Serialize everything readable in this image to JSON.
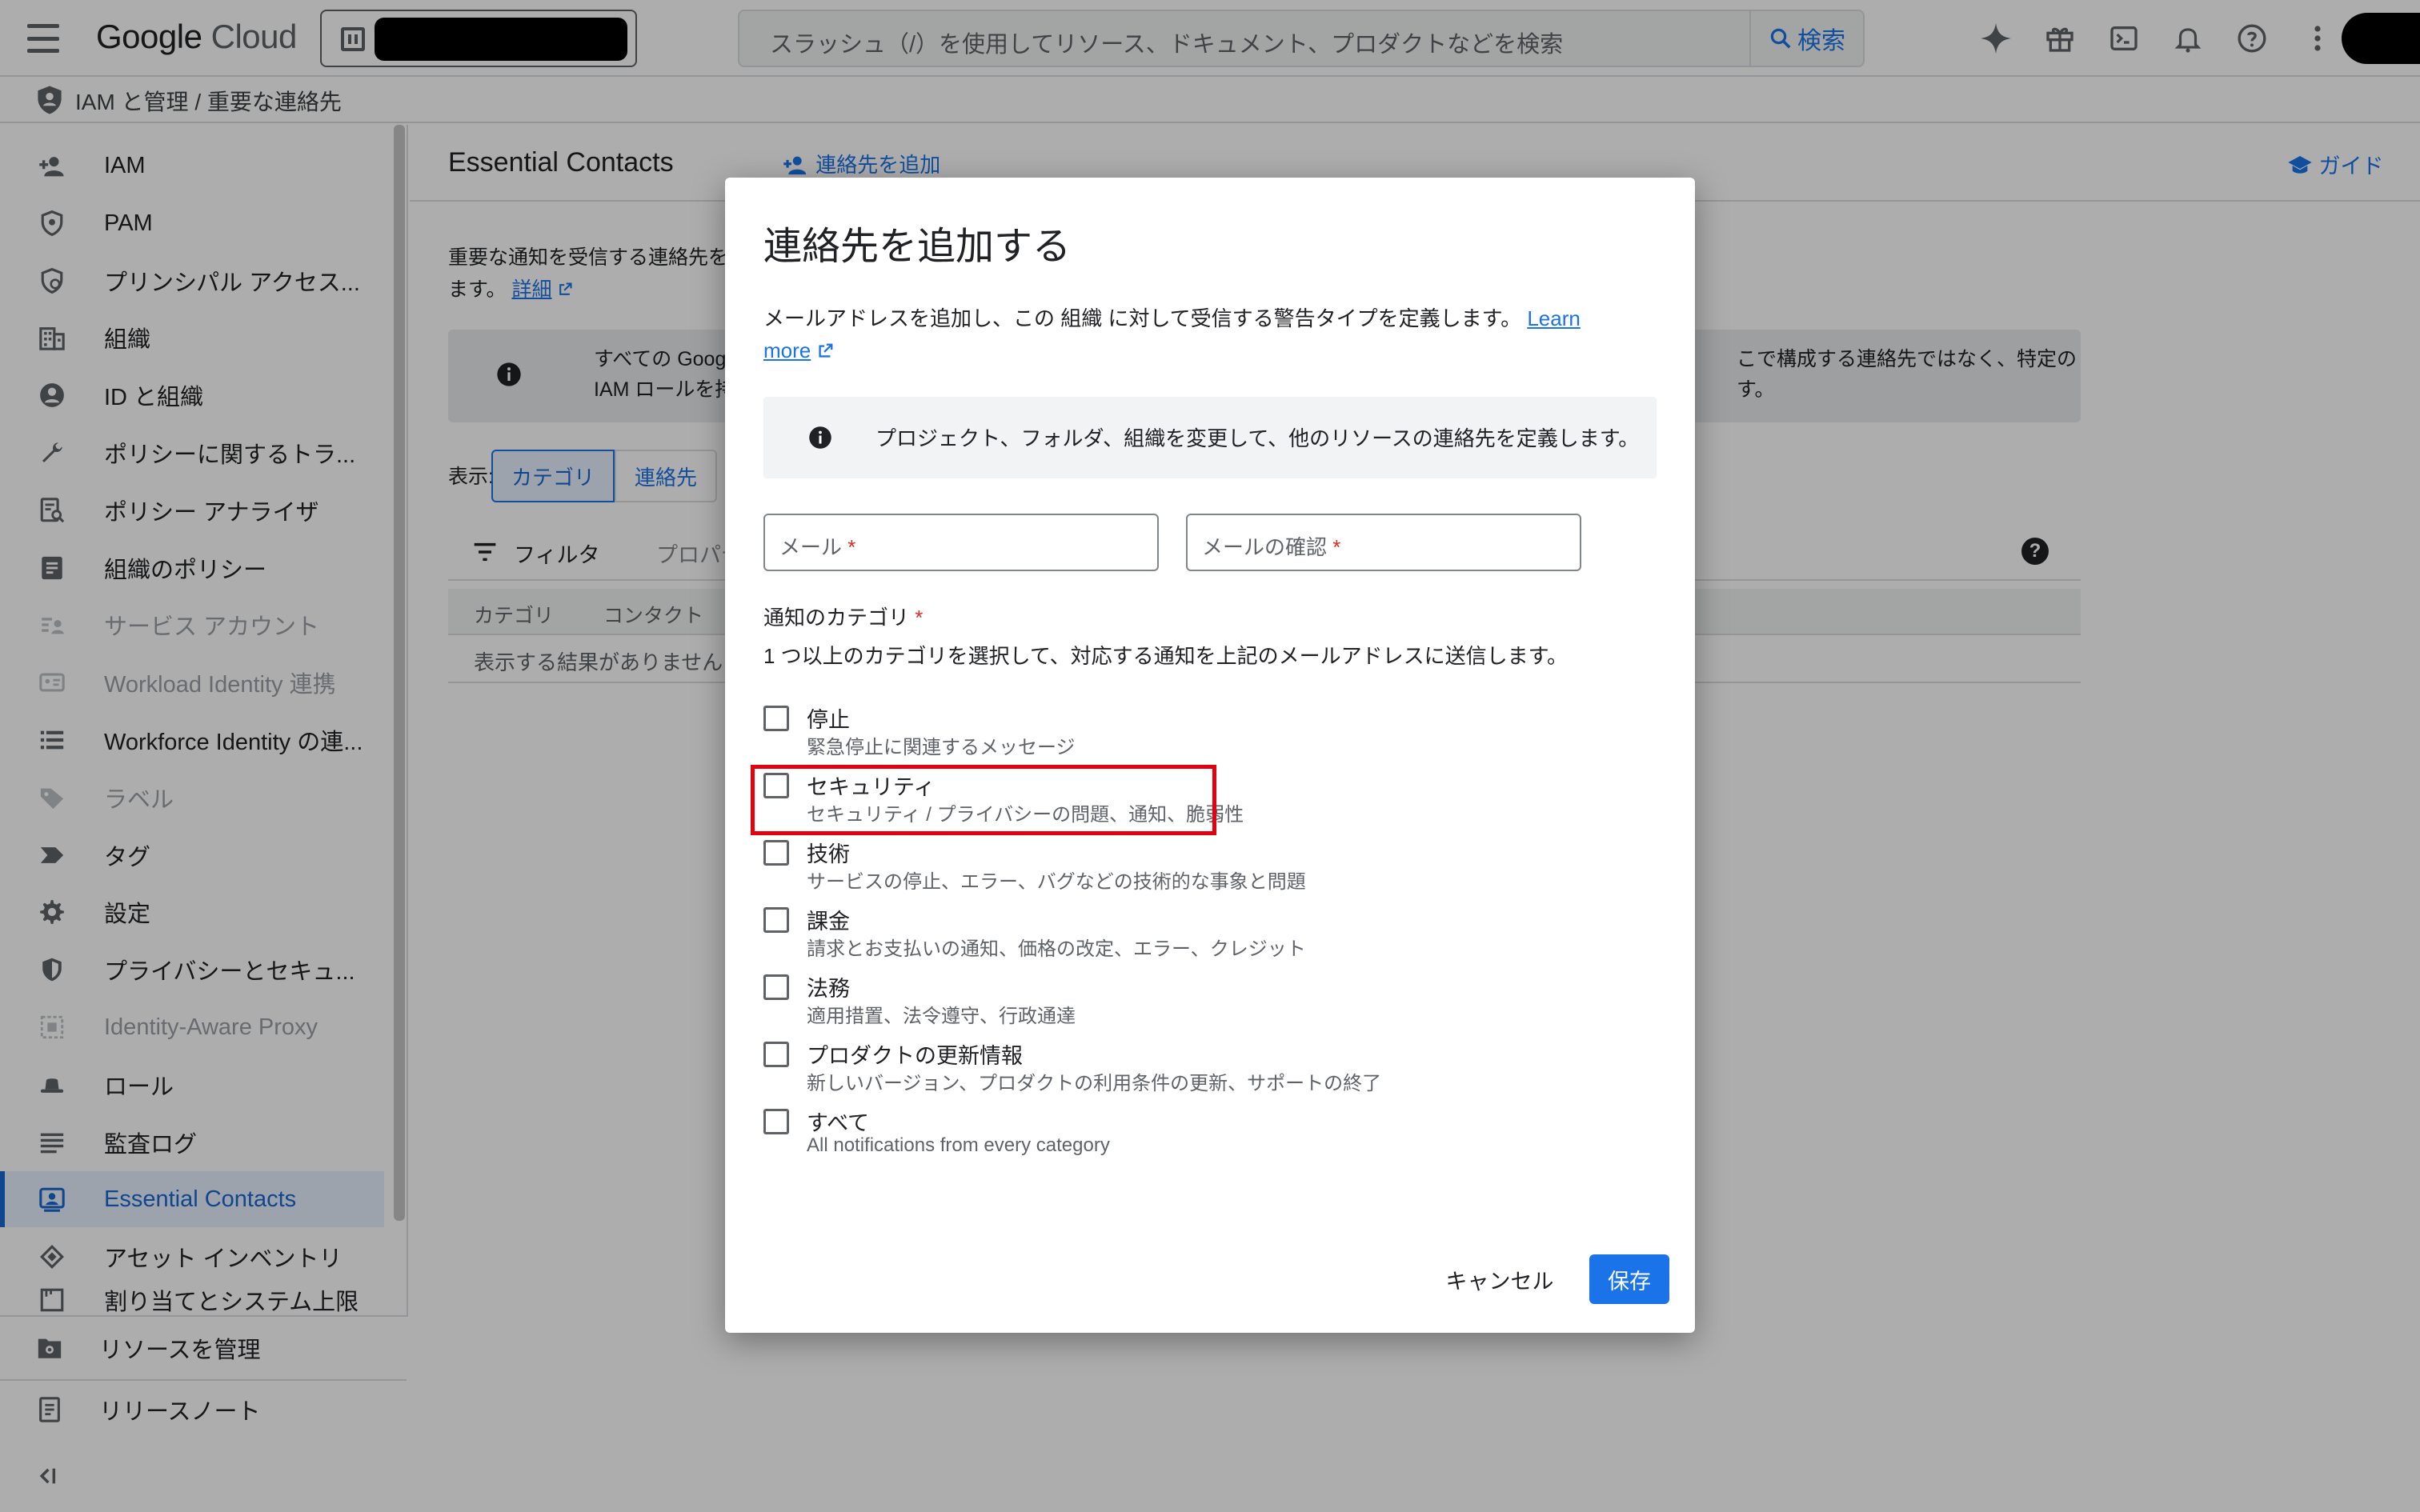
{
  "header": {
    "logo_google": "Google",
    "logo_cloud": "Cloud",
    "search_placeholder": "スラッシュ（/）を使用してリソース、ドキュメント、プロダクトなどを検索",
    "search_button": "検索"
  },
  "breadcrumb": {
    "text": "IAM と管理  /  重要な連絡先"
  },
  "sidebar": {
    "items": [
      {
        "label": "IAM",
        "icon": "person-add-icon",
        "state": "normal"
      },
      {
        "label": "PAM",
        "icon": "shield-lock-icon",
        "state": "normal"
      },
      {
        "label": "プリンシパル アクセス...",
        "icon": "principal-access-icon",
        "state": "normal"
      },
      {
        "label": "組織",
        "icon": "building-icon",
        "state": "normal"
      },
      {
        "label": "ID と組織",
        "icon": "account-circle-icon",
        "state": "normal"
      },
      {
        "label": "ポリシーに関するトラ...",
        "icon": "wrench-icon",
        "state": "normal"
      },
      {
        "label": "ポリシー アナライザ",
        "icon": "policy-analyzer-icon",
        "state": "normal"
      },
      {
        "label": "組織のポリシー",
        "icon": "document-list-icon",
        "state": "normal"
      },
      {
        "label": "サービス アカウント",
        "icon": "service-account-icon",
        "state": "disabled"
      },
      {
        "label": "Workload Identity 連携",
        "icon": "id-card-icon",
        "state": "disabled"
      },
      {
        "label": "Workforce Identity の連...",
        "icon": "list-icon",
        "state": "normal"
      },
      {
        "label": "ラベル",
        "icon": "label-icon",
        "state": "disabled"
      },
      {
        "label": "タグ",
        "icon": "tag-icon",
        "state": "normal"
      },
      {
        "label": "設定",
        "icon": "gear-icon",
        "state": "normal"
      },
      {
        "label": "プライバシーとセキュ...",
        "icon": "privacy-shield-icon",
        "state": "normal"
      },
      {
        "label": "Identity-Aware Proxy",
        "icon": "iap-icon",
        "state": "disabled"
      },
      {
        "label": "ロール",
        "icon": "hat-icon",
        "state": "normal"
      },
      {
        "label": "監査ログ",
        "icon": "lines-icon",
        "state": "normal"
      },
      {
        "label": "Essential Contacts",
        "icon": "contacts-icon",
        "state": "active"
      },
      {
        "label": "アセット インベントリ",
        "icon": "inventory-icon",
        "state": "normal"
      },
      {
        "label": "割り当てとシステム上限",
        "icon": "quota-icon",
        "state": "normal"
      }
    ],
    "bottom": {
      "manage_resources": "リソースを管理",
      "release_notes": "リリースノート"
    }
  },
  "main": {
    "title": "Essential Contacts",
    "add_contact": "連絡先を追加",
    "guide": "ガイド",
    "description": "重要な通知を受信する連絡先を",
    "description_line2": "ます。",
    "details_link": "詳細",
    "banner_line1": "すべての Google C",
    "banner_line2": "IAM ロールを持っ",
    "banner_right_line1": "こで構成する連絡先ではなく、特定の",
    "banner_right_line2": "す。",
    "view_label": "表示:",
    "view_tabs": [
      "カテゴリ",
      "連絡先"
    ],
    "filter_label": "フィルタ",
    "filter_property": "プロパティ",
    "columns": [
      "カテゴリ",
      "コンタクト"
    ],
    "empty_text": "表示する結果がありません"
  },
  "dialog": {
    "title": "連絡先を追加する",
    "description": "メールアドレスを追加し、この 組織 に対して受信する警告タイプを定義します。",
    "learn_more": "Learn more",
    "info_text": "プロジェクト、フォルダ、組織を変更して、他のリソースの連絡先を定義します。",
    "email_label": "メール",
    "email_confirm_label": "メールの確認",
    "required_mark": "*",
    "categories_title": "通知のカテゴリ",
    "categories_subtitle": "1 つ以上のカテゴリを選択して、対応する通知を上記のメールアドレスに送信します。",
    "categories": [
      {
        "label": "停止",
        "desc": "緊急停止に関連するメッセージ",
        "checked": false
      },
      {
        "label": "セキュリティ",
        "desc": "セキュリティ / プライバシーの問題、通知、脆弱性",
        "checked": false
      },
      {
        "label": "技術",
        "desc": "サービスの停止、エラー、バグなどの技術的な事象と問題",
        "checked": false
      },
      {
        "label": "課金",
        "desc": "請求とお支払いの通知、価格の改定、エラー、クレジット",
        "checked": false
      },
      {
        "label": "法務",
        "desc": "適用措置、法令遵守、行政通達",
        "checked": false
      },
      {
        "label": "プロダクトの更新情報",
        "desc": "新しいバージョン、プロダクトの利用条件の更新、サポートの終了",
        "checked": false
      },
      {
        "label": "すべて",
        "desc": "All notifications from every category",
        "checked": false
      }
    ],
    "cancel": "キャンセル",
    "save": "保存"
  },
  "colors": {
    "accent": "#1a73e8",
    "active_nav_bg": "#e8f0fe",
    "highlight_box": "#e3000f",
    "required": "#d93025"
  }
}
